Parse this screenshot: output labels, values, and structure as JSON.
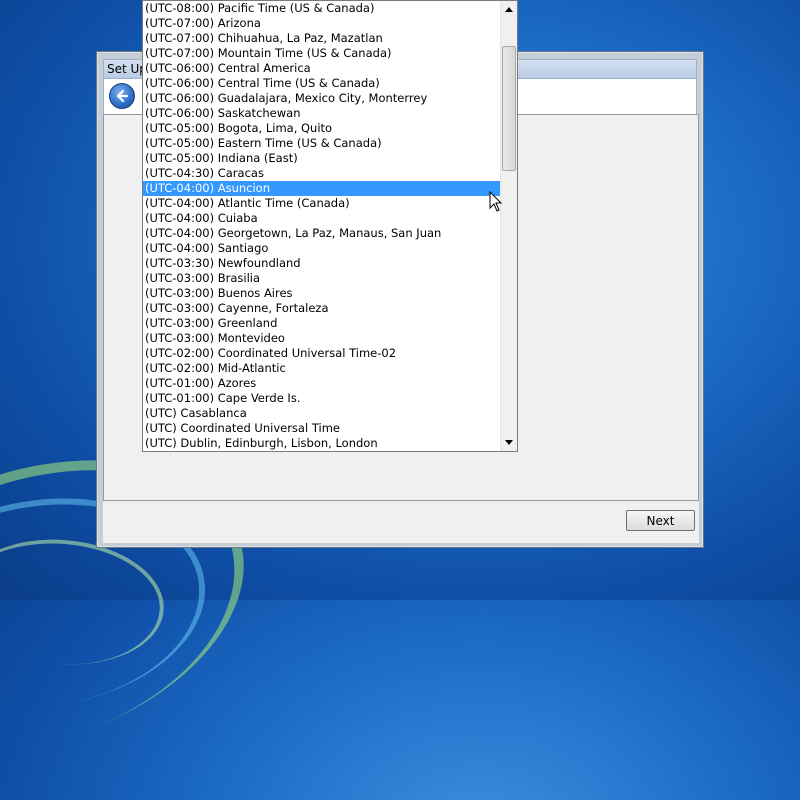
{
  "window": {
    "title": "Set Up",
    "next_label": "Next"
  },
  "timezone_list": {
    "items": [
      "(UTC-08:00) Pacific Time (US & Canada)",
      "(UTC-07:00) Arizona",
      "(UTC-07:00) Chihuahua, La Paz, Mazatlan",
      "(UTC-07:00) Mountain Time (US & Canada)",
      "(UTC-06:00) Central America",
      "(UTC-06:00) Central Time (US & Canada)",
      "(UTC-06:00) Guadalajara, Mexico City, Monterrey",
      "(UTC-06:00) Saskatchewan",
      "(UTC-05:00) Bogota, Lima, Quito",
      "(UTC-05:00) Eastern Time (US & Canada)",
      "(UTC-05:00) Indiana (East)",
      "(UTC-04:30) Caracas",
      "(UTC-04:00) Asuncion",
      "(UTC-04:00) Atlantic Time (Canada)",
      "(UTC-04:00) Cuiaba",
      "(UTC-04:00) Georgetown, La Paz, Manaus, San Juan",
      "(UTC-04:00) Santiago",
      "(UTC-03:30) Newfoundland",
      "(UTC-03:00) Brasilia",
      "(UTC-03:00) Buenos Aires",
      "(UTC-03:00) Cayenne, Fortaleza",
      "(UTC-03:00) Greenland",
      "(UTC-03:00) Montevideo",
      "(UTC-02:00) Coordinated Universal Time-02",
      "(UTC-02:00) Mid-Atlantic",
      "(UTC-01:00) Azores",
      "(UTC-01:00) Cape Verde Is.",
      "(UTC) Casablanca",
      "(UTC) Coordinated Universal Time",
      "(UTC) Dublin, Edinburgh, Lisbon, London"
    ],
    "selected": "(UTC-04:00) Asuncion"
  },
  "colors": {
    "selection": "#3399ff",
    "desktop": "#1e6fc8"
  },
  "icons": {
    "back": "back-arrow-icon",
    "scroll_up": "triangle-up-icon",
    "scroll_down": "triangle-down-icon",
    "cursor": "mouse-pointer-icon"
  }
}
